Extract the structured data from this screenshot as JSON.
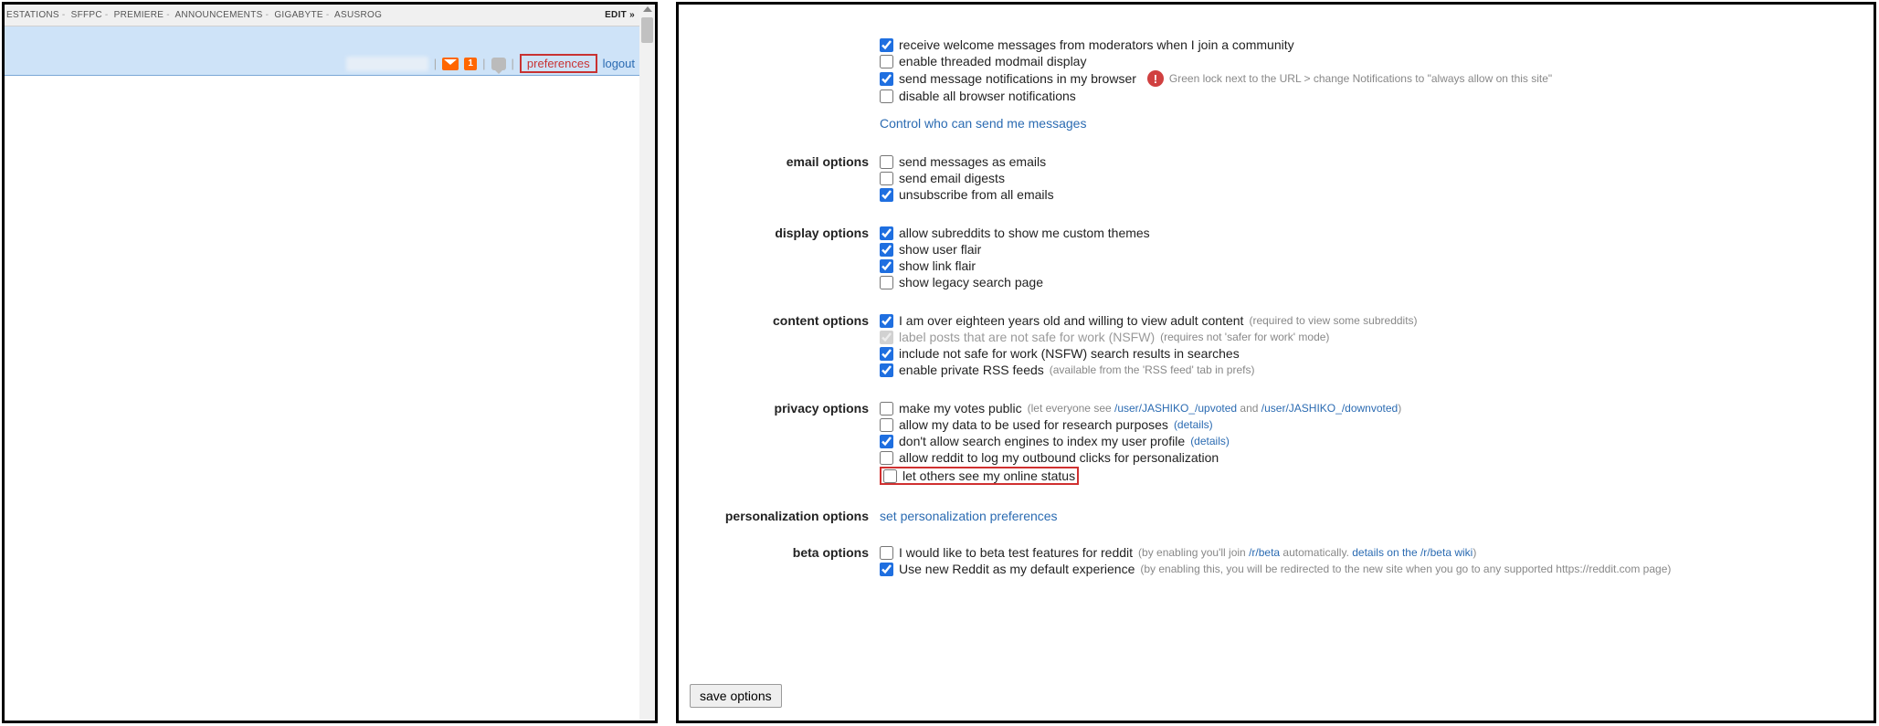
{
  "left": {
    "subreddits": [
      "ESTATIONS",
      "SFFPC",
      "PREMIERE",
      "ANNOUNCEMENTS",
      "GIGABYTE",
      "ASUSROG"
    ],
    "edit_label": "EDIT »",
    "userbar": {
      "mail_badge": "1",
      "prefs_label": "preferences",
      "logout_label": "logout"
    }
  },
  "prefs": {
    "sections": {
      "messaging_head": "",
      "messaging": {
        "welcome": "receive welcome messages from moderators when I join a community",
        "threaded_modmail": "enable threaded modmail display",
        "browser_notif": "send message notifications in my browser",
        "browser_notif_hint": "Green lock next to the URL > change Notifications to \"always allow on this site\"",
        "disable_notif": "disable all browser notifications",
        "control_link": "Control who can send me messages"
      },
      "email_head": "email options",
      "email": {
        "as_emails": "send messages as emails",
        "digests": "send email digests",
        "unsub": "unsubscribe from all emails"
      },
      "display_head": "display options",
      "display": {
        "themes": "allow subreddits to show me custom themes",
        "user_flair": "show user flair",
        "link_flair": "show link flair",
        "legacy_search": "show legacy search page"
      },
      "content_head": "content options",
      "content": {
        "over18": "I am over eighteen years old and willing to view adult content",
        "over18_hint": "(required to view some subreddits)",
        "label_nsfw": "label posts that are not safe for work (NSFW)",
        "label_nsfw_hint": "(requires not 'safer for work' mode)",
        "nsfw_search": "include not safe for work (NSFW) search results in searches",
        "rss": "enable private RSS feeds",
        "rss_hint": "(available from the 'RSS feed' tab in prefs)"
      },
      "privacy_head": "privacy options",
      "privacy": {
        "votes_public": "make my votes public",
        "votes_hint_pre": "(let everyone see ",
        "votes_link1": "/user/JASHIKO_/upvoted",
        "votes_hint_mid": " and ",
        "votes_link2": "/user/JASHIKO_/downvoted",
        "votes_hint_post": ")",
        "research": "allow my data to be used for research purposes",
        "research_link": "(details)",
        "noindex": "don't allow search engines to index my user profile",
        "noindex_link": "(details)",
        "outbound": "allow reddit to log my outbound clicks for personalization",
        "online": "let others see my online status"
      },
      "personalization_head": "personalization options",
      "personalization_link": "set personalization preferences",
      "beta_head": "beta options",
      "beta": {
        "beta_test": "I would like to beta test features for reddit",
        "beta_hint_pre": "(by enabling you'll join ",
        "beta_link1": "/r/beta",
        "beta_hint_mid": " automatically. ",
        "beta_link2": "details on the /r/beta wiki",
        "beta_hint_post": ")",
        "new_reddit": "Use new Reddit as my default experience",
        "new_reddit_hint": "(by enabling this, you will be redirected to the new site when you go to any supported https://reddit.com page)"
      }
    },
    "save_label": "save options"
  }
}
